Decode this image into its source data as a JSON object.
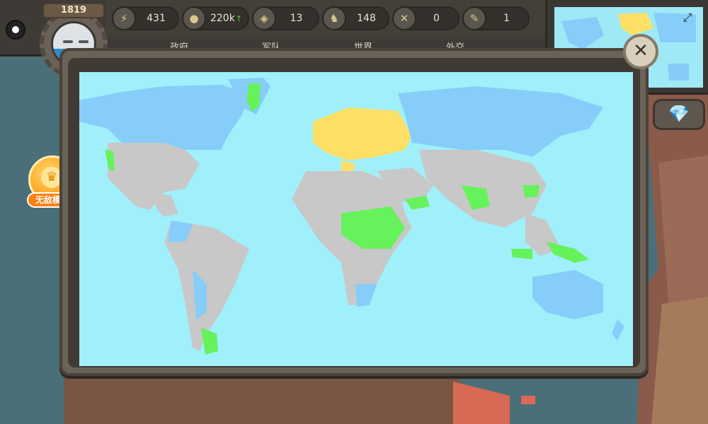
{
  "hud": {
    "year": "1819",
    "resources": [
      {
        "icon": "lightning-icon",
        "symbol": "⚡",
        "value": "431",
        "trend": ""
      },
      {
        "icon": "money-icon",
        "symbol": "●",
        "value": "220k",
        "trend": "↑"
      },
      {
        "icon": "box-icon",
        "symbol": "◈",
        "value": "13",
        "trend": ""
      },
      {
        "icon": "soldier-icon",
        "symbol": "♞",
        "value": "148",
        "trend": ""
      },
      {
        "icon": "crossed-swords-icon",
        "symbol": "✕",
        "value": "0",
        "trend": ""
      },
      {
        "icon": "pen-icon",
        "symbol": "✎",
        "value": "1",
        "trend": ""
      }
    ],
    "tabs": [
      "政府",
      "军队",
      "世界",
      "外交"
    ]
  },
  "invincible": {
    "label": "无敌模式"
  },
  "buttons": {
    "close": "✕",
    "diamond": "💎",
    "expand": "⤢"
  },
  "colors": {
    "ocean": "#9ff0fb",
    "ally": "#86cdf9",
    "neutral": "#c8c8c8",
    "player": "#ffe066",
    "friend": "#66f25a"
  }
}
